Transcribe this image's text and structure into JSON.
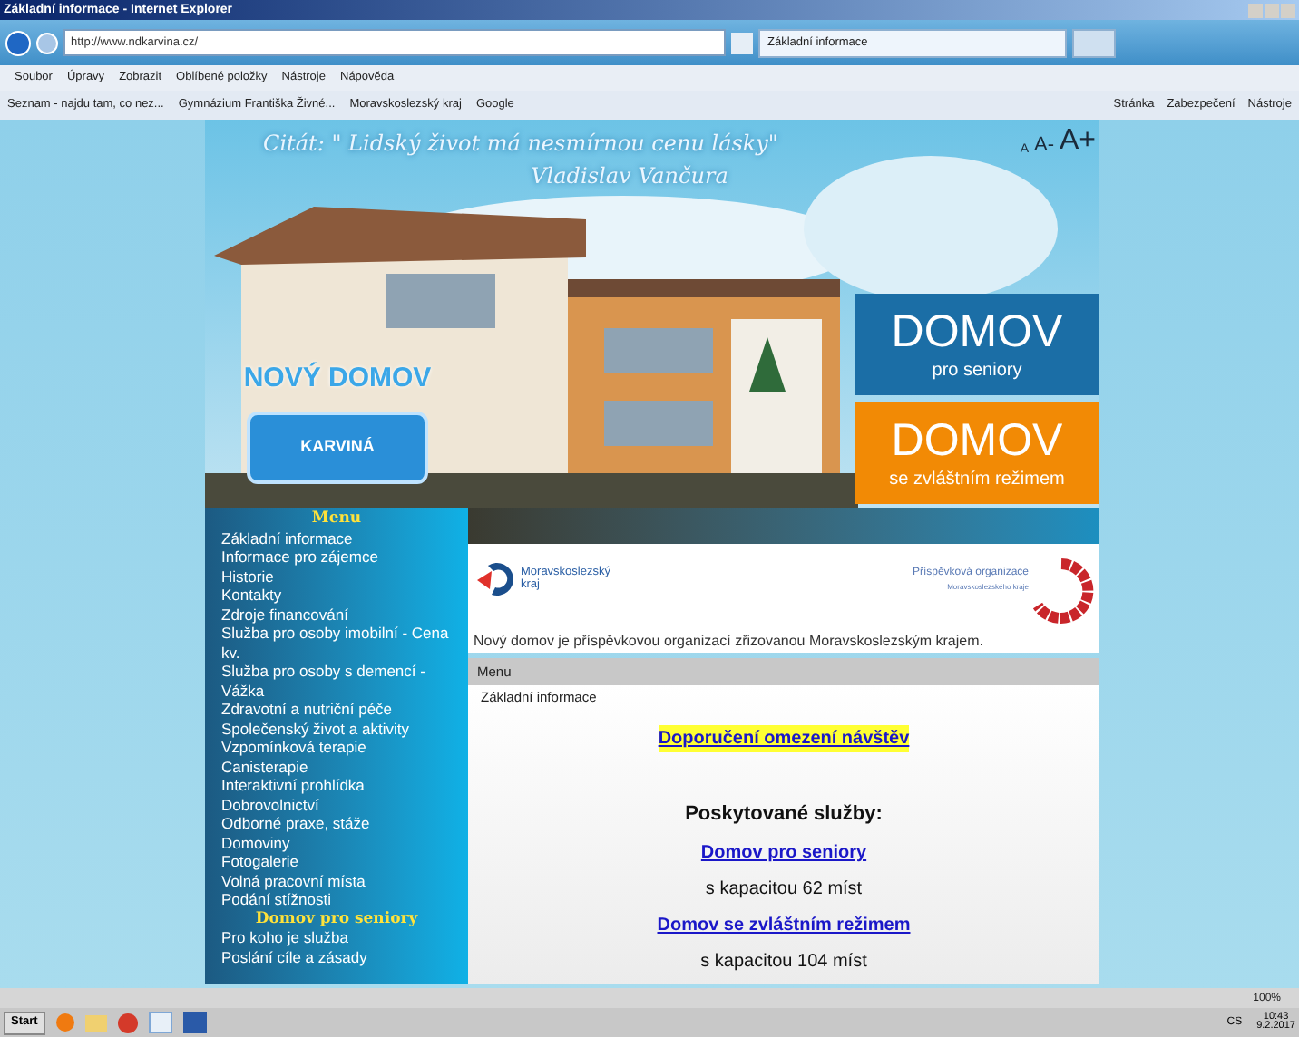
{
  "window": {
    "title": "Základní informace - Internet Explorer"
  },
  "browser": {
    "address": "http://www.ndkarvina.cz/",
    "tabs": [
      {
        "label": "Základní informace",
        "selected": true
      }
    ],
    "menu": [
      "Soubor",
      "Úpravy",
      "Zobrazit",
      "Oblíbené položky",
      "Nástroje",
      "Nápověda"
    ],
    "favorites": [
      "Seznam - najdu tam, co nez...",
      "Gymnázium Františka Živné...",
      "Moravskoslezský kraj",
      "Google"
    ],
    "commands": [
      "Stránka",
      "Zabezpečení",
      "Nástroje"
    ]
  },
  "header": {
    "quote": "Citát: \" Lidský život má nesmírnou cenu lásky\"",
    "author": "Vladislav Vančura",
    "font_sizes": [
      "A",
      "A-",
      "A+"
    ],
    "logo": {
      "title": "NOVÝ DOMOV",
      "city": "KARVINÁ"
    },
    "tiles": [
      {
        "title": "DOMOV",
        "subtitle": "pro seniory",
        "color": "#1b6ea6"
      },
      {
        "title": "DOMOV",
        "subtitle": "se zvláštním režimem",
        "color": "#f28a05"
      }
    ]
  },
  "sidebar": {
    "items": [
      {
        "kind": "heading",
        "label": "Menu"
      },
      {
        "kind": "link",
        "label": "Základní informace"
      },
      {
        "kind": "link",
        "label": "Informace pro zájemce"
      },
      {
        "kind": "link",
        "label": "Historie"
      },
      {
        "kind": "link",
        "label": "Kontakty"
      },
      {
        "kind": "link",
        "label": "Zdroje financování"
      },
      {
        "kind": "link",
        "label": "Služba pro osoby imobilní - Cena kv."
      },
      {
        "kind": "link",
        "label": "Služba pro osoby s demencí - Vážka"
      },
      {
        "kind": "link",
        "label": "Zdravotní a nutriční péče"
      },
      {
        "kind": "link",
        "label": "Společenský život a aktivity"
      },
      {
        "kind": "link",
        "label": "Vzpomínková terapie"
      },
      {
        "kind": "link",
        "label": "Canisterapie"
      },
      {
        "kind": "link",
        "label": "Interaktivní prohlídka"
      },
      {
        "kind": "link",
        "label": "Dobrovolnictví"
      },
      {
        "kind": "link",
        "label": "Odborné praxe, stáže"
      },
      {
        "kind": "link",
        "label": "Domoviny"
      },
      {
        "kind": "link",
        "label": "Fotogalerie"
      },
      {
        "kind": "link",
        "label": "Volná pracovní místa"
      },
      {
        "kind": "link",
        "label": "Podání stížnosti"
      },
      {
        "kind": "heading",
        "label": "Domov pro seniory"
      },
      {
        "kind": "link",
        "label": "Pro koho je služba"
      },
      {
        "kind": "link",
        "label": "Poslání cíle a zásady"
      }
    ]
  },
  "main": {
    "region": "Moravskoslezský kraj",
    "org": "Příspěvková organizace",
    "org_sub": "Moravskoslezského kraje",
    "caption": "Nový domov je příspěvkovou organizací zřizovanou Moravskoslezským krajem.",
    "menu_bar": "Menu",
    "breadcrumb": "Základní informace",
    "content": [
      {
        "kind": "notice",
        "text": "Doporučení omezení návštěv"
      },
      {
        "kind": "heading",
        "text": "Poskytované služby:"
      },
      {
        "kind": "link",
        "text": "Domov pro seniory"
      },
      {
        "kind": "text",
        "text": "s kapacitou 62 míst"
      },
      {
        "kind": "link",
        "text": "Domov se zvláštním režimem"
      },
      {
        "kind": "text",
        "text": "s kapacitou 104 míst"
      }
    ]
  },
  "status_bar": {
    "zoom": "100%"
  },
  "taskbar": {
    "start": "Start",
    "language": "CS",
    "time": "10:43",
    "date": "9.2.2017"
  }
}
